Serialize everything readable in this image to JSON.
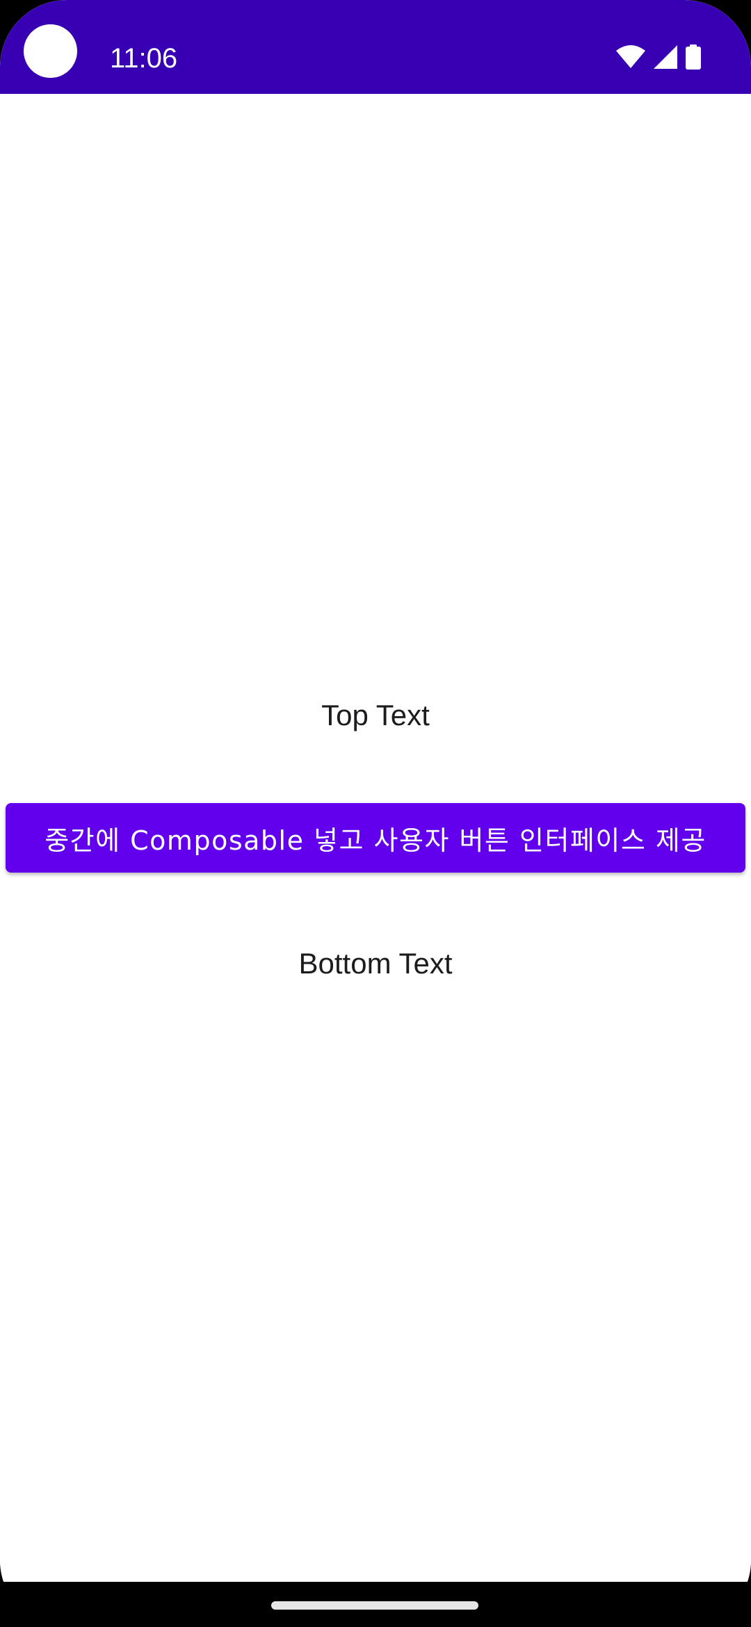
{
  "status_bar": {
    "time": "11:06",
    "background_color": "#3700b3",
    "icons": [
      "wifi-icon",
      "cellular-signal-icon",
      "battery-icon"
    ]
  },
  "main": {
    "top_text": "Top Text",
    "button_label": "중간에 Composable 넣고 사용자 버튼 인터페이스 제공",
    "bottom_text": "Bottom Text",
    "button_color": "#6200ee"
  },
  "nav_bar": {
    "background_color": "#000000",
    "home_indicator": "home-indicator"
  }
}
